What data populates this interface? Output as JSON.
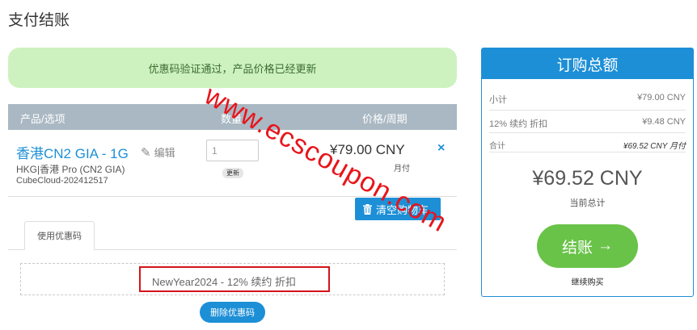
{
  "page": {
    "title": "支付结账"
  },
  "alert": {
    "message": "优惠码验证通过，产品价格已经更新"
  },
  "cart": {
    "headers": {
      "product": "产品/选项",
      "quantity": "数量",
      "price": "价格/周期"
    },
    "item": {
      "name": "香港CN2 GIA - 1G",
      "edit_label": "编辑",
      "description": "HKG|香港 Pro (CN2 GIA)",
      "hostname": "CubeCloud-202412517",
      "quantity": "1",
      "update_label": "更新",
      "price": "¥79.00 CNY",
      "cycle": "月付",
      "remove_icon": "×"
    },
    "empty_cart_label": "清空购物车"
  },
  "promo": {
    "tab_label": "使用优惠码",
    "applied_text": "NewYear2024 - 12% 续约 折扣",
    "remove_label": "删除优惠码"
  },
  "summary": {
    "title": "订购总额",
    "rows": [
      {
        "label": "小计",
        "value": "¥79.00 CNY"
      },
      {
        "label": "12% 续约 折扣",
        "value": "¥9.48 CNY"
      },
      {
        "label": "合计",
        "value": "¥69.52 CNY 月付"
      }
    ],
    "total": "¥69.52 CNY",
    "total_label": "当前总计",
    "checkout_label": "结账",
    "checkout_icon": "→",
    "continue_label": "继续购买"
  },
  "watermark": {
    "text": "www.ecscoupon.com"
  },
  "colors": {
    "accent": "#1d8fd6",
    "success_bg": "#cdf2c0",
    "checkout": "#69c348",
    "highlight_border": "#d3141a",
    "watermark": "#e8141b"
  }
}
